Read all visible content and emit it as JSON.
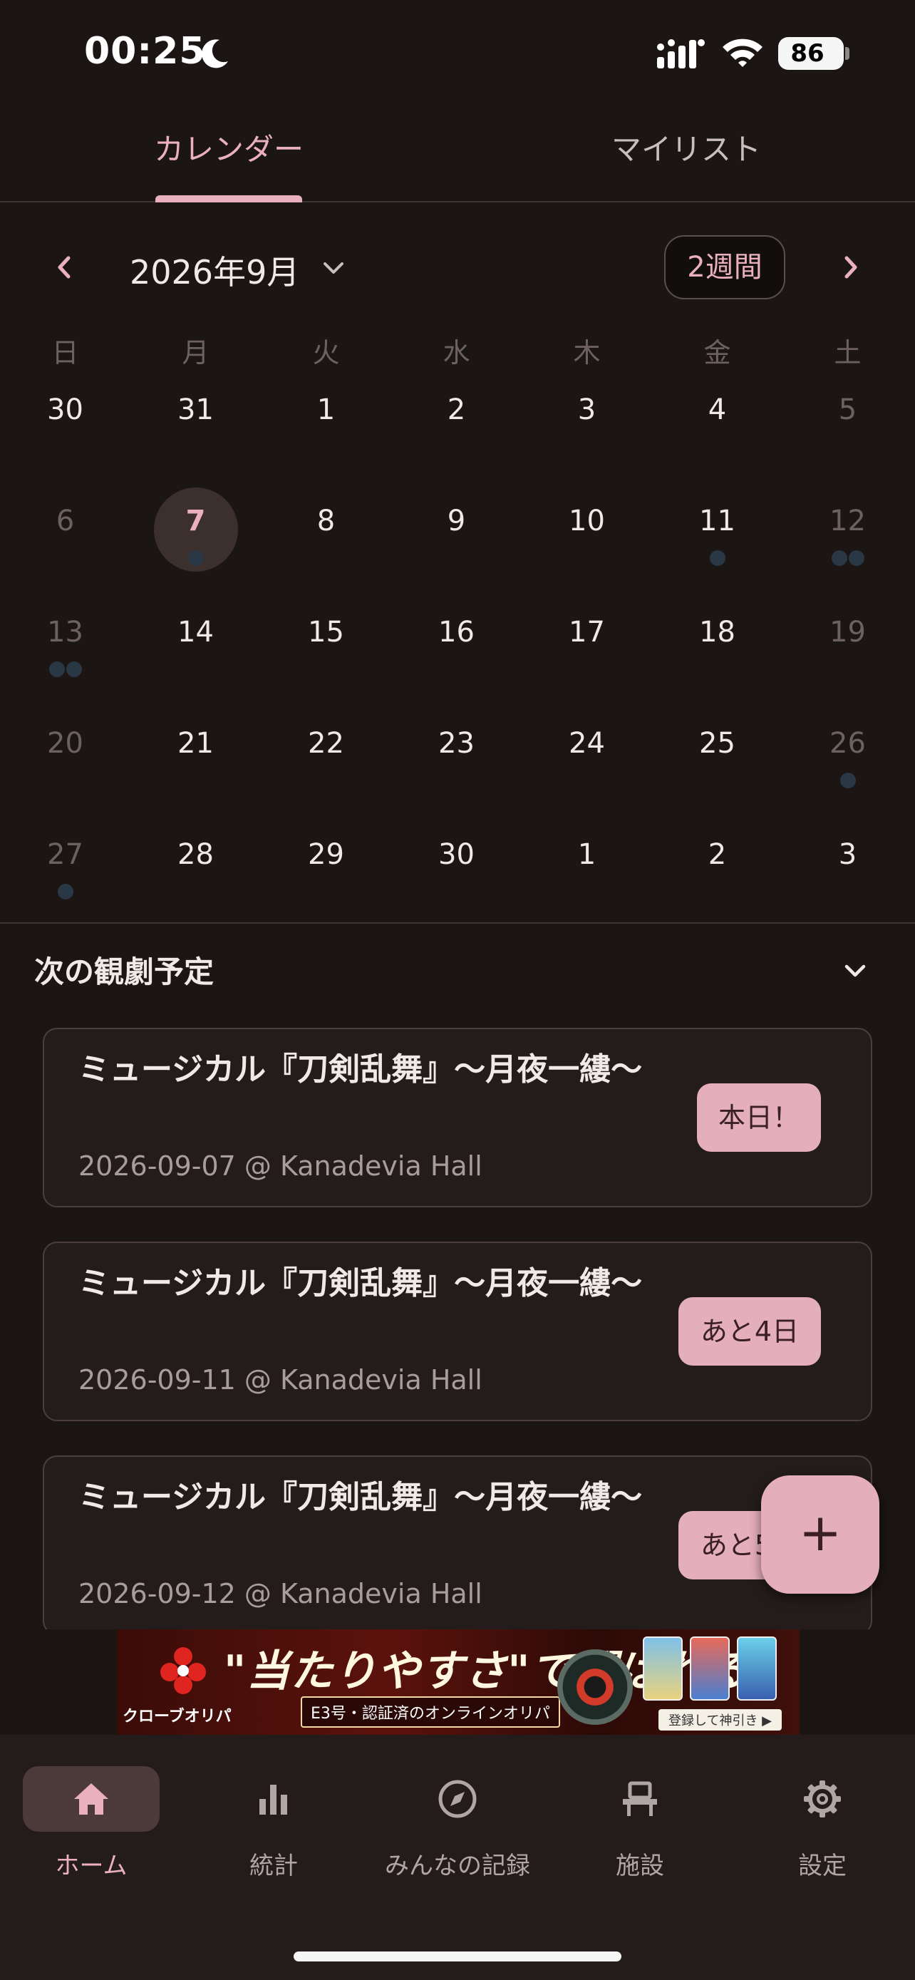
{
  "status_bar": {
    "time": "00:25",
    "battery": "86"
  },
  "tabs": [
    {
      "label": "カレンダー",
      "active": true
    },
    {
      "label": "マイリスト",
      "active": false
    }
  ],
  "calendar": {
    "month_label": "2026年9月",
    "view_toggle": "2週間",
    "prev_icon": "chevron-left-icon",
    "next_icon": "chevron-right-icon",
    "weekdays": [
      "日",
      "月",
      "火",
      "水",
      "木",
      "金",
      "土"
    ],
    "weeks": [
      [
        {
          "d": "30",
          "muted": false,
          "dots": 0
        },
        {
          "d": "31",
          "muted": false,
          "dots": 0
        },
        {
          "d": "1",
          "muted": false,
          "dots": 0
        },
        {
          "d": "2",
          "muted": false,
          "dots": 0
        },
        {
          "d": "3",
          "muted": false,
          "dots": 0
        },
        {
          "d": "4",
          "muted": false,
          "dots": 0
        },
        {
          "d": "5",
          "muted": true,
          "dots": 0
        }
      ],
      [
        {
          "d": "6",
          "muted": true,
          "dots": 0
        },
        {
          "d": "7",
          "muted": false,
          "dots": 1,
          "today": true
        },
        {
          "d": "8",
          "muted": false,
          "dots": 0
        },
        {
          "d": "9",
          "muted": false,
          "dots": 0
        },
        {
          "d": "10",
          "muted": false,
          "dots": 0
        },
        {
          "d": "11",
          "muted": false,
          "dots": 1
        },
        {
          "d": "12",
          "muted": true,
          "dots": 2
        }
      ],
      [
        {
          "d": "13",
          "muted": true,
          "dots": 2
        },
        {
          "d": "14",
          "muted": false,
          "dots": 0
        },
        {
          "d": "15",
          "muted": false,
          "dots": 0
        },
        {
          "d": "16",
          "muted": false,
          "dots": 0
        },
        {
          "d": "17",
          "muted": false,
          "dots": 0
        },
        {
          "d": "18",
          "muted": false,
          "dots": 0
        },
        {
          "d": "19",
          "muted": true,
          "dots": 0
        }
      ],
      [
        {
          "d": "20",
          "muted": true,
          "dots": 0
        },
        {
          "d": "21",
          "muted": false,
          "dots": 0
        },
        {
          "d": "22",
          "muted": false,
          "dots": 0
        },
        {
          "d": "23",
          "muted": false,
          "dots": 0
        },
        {
          "d": "24",
          "muted": false,
          "dots": 0
        },
        {
          "d": "25",
          "muted": false,
          "dots": 0
        },
        {
          "d": "26",
          "muted": true,
          "dots": 1
        }
      ],
      [
        {
          "d": "27",
          "muted": true,
          "dots": 1
        },
        {
          "d": "28",
          "muted": false,
          "dots": 0
        },
        {
          "d": "29",
          "muted": false,
          "dots": 0
        },
        {
          "d": "30",
          "muted": false,
          "dots": 0
        },
        {
          "d": "1",
          "muted": false,
          "dots": 0
        },
        {
          "d": "2",
          "muted": false,
          "dots": 0
        },
        {
          "d": "3",
          "muted": false,
          "dots": 0
        }
      ]
    ]
  },
  "upcoming": {
    "title": "次の観劇予定",
    "items": [
      {
        "title": "ミュージカル『刀剣乱舞』〜月夜一縷〜",
        "subtitle": "2026-09-07 @ Kanadevia Hall",
        "badge": "本日！"
      },
      {
        "title": "ミュージカル『刀剣乱舞』〜月夜一縷〜",
        "subtitle": "2026-09-11 @ Kanadevia Hall",
        "badge": "あと4日"
      },
      {
        "title": "ミュージカル『刀剣乱舞』〜月夜一縷〜",
        "subtitle": "2026-09-12 @ Kanadevia Hall",
        "badge": "あと5日"
      }
    ]
  },
  "fab": {
    "label": "+"
  },
  "ad": {
    "headline": "\"当たりやすさ\"で選ばれる",
    "brand": "クローブオリパ",
    "sub": "E3号・認証済のオンラインオリパ",
    "button": "登録して神引き ▶"
  },
  "bottom_nav": [
    {
      "label": "ホーム",
      "icon": "home-icon",
      "active": true
    },
    {
      "label": "統計",
      "icon": "bar-chart-icon",
      "active": false
    },
    {
      "label": "みんなの記録",
      "icon": "compass-icon",
      "active": false
    },
    {
      "label": "施設",
      "icon": "theater-seat-icon",
      "active": false
    },
    {
      "label": "設定",
      "icon": "gear-icon",
      "active": false
    }
  ],
  "colors": {
    "accent": "#eab0bd",
    "background": "#1b1514",
    "card": "#241c1a",
    "event_dot": "#2a3846"
  }
}
